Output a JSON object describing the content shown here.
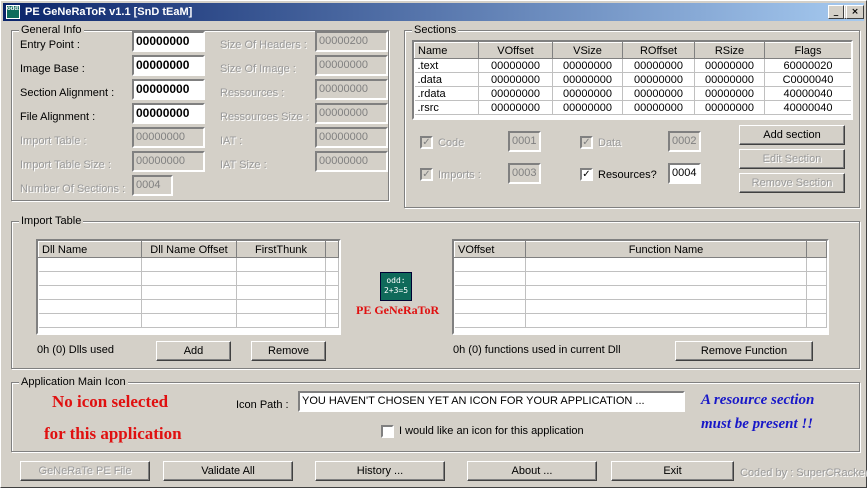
{
  "window": {
    "title": "PE GeNeRaToR v1.1 [SnD tEaM]",
    "app_icon": "pe-generator-icon",
    "minimize": "_",
    "maximize": "□",
    "close": "×"
  },
  "general_info": {
    "label": "General Info",
    "entry_point": {
      "label": "Entry Point :",
      "value": "00000000"
    },
    "image_base": {
      "label": "Image Base :",
      "value": "00000000"
    },
    "section_alignment": {
      "label": "Section Alignment :",
      "value": "00000000"
    },
    "file_alignment": {
      "label": "File Alignment :",
      "value": "00000000"
    },
    "import_table": {
      "label": "Import Table :",
      "value": "00000000"
    },
    "import_table_size": {
      "label": "Import Table Size :",
      "value": "00000000"
    },
    "number_of_sections": {
      "label": "Number Of Sections :",
      "value": "0004"
    },
    "size_of_headers": {
      "label": "Size Of Headers :",
      "value": "00000200"
    },
    "size_of_image": {
      "label": "Size Of Image :",
      "value": "00000000"
    },
    "ressources": {
      "label": "Ressources :",
      "value": "00000000"
    },
    "ressources_size": {
      "label": "Ressources Size :",
      "value": "00000000"
    },
    "iat": {
      "label": "IAT :",
      "value": "00000000"
    },
    "iat_size": {
      "label": "IAT Size :",
      "value": "00000000"
    }
  },
  "sections": {
    "label": "Sections",
    "columns": [
      "Name",
      "VOffset",
      "VSize",
      "ROffset",
      "RSize",
      "Flags"
    ],
    "rows": [
      [
        ".text",
        "00000000",
        "00000000",
        "00000000",
        "00000000",
        "60000020"
      ],
      [
        ".data",
        "00000000",
        "00000000",
        "00000000",
        "00000000",
        "C0000040"
      ],
      [
        ".rdata",
        "00000000",
        "00000000",
        "00000000",
        "00000000",
        "40000040"
      ],
      [
        ".rsrc",
        "00000000",
        "00000000",
        "00000000",
        "00000000",
        "40000040"
      ]
    ],
    "code": {
      "label": "Code",
      "value": "0001",
      "checked": "✓"
    },
    "data": {
      "label": "Data",
      "value": "0002",
      "checked": "✓"
    },
    "imports": {
      "label": "Imports :",
      "value": "0003",
      "checked": "✓"
    },
    "resources": {
      "label": "Resources?",
      "value": "0004",
      "checked": "✓"
    },
    "add_section": "Add section",
    "edit_section": "Edit Section",
    "remove_section": "Remove Section"
  },
  "import_table": {
    "label": "Import Table",
    "dll_columns": [
      "Dll Name",
      "Dll Name Offset",
      "FirstThunk"
    ],
    "dll_count": "0h (0) Dlls used",
    "add": "Add",
    "remove": "Remove",
    "func_columns": [
      "VOffset",
      "Function Name"
    ],
    "func_count": "0h (0) functions used in current Dll",
    "remove_function": "Remove Function",
    "logo_text": "PE GeNeRaToR",
    "logo_icon_line1": "odd:",
    "logo_icon_line2": "2+3=5"
  },
  "icon_group": {
    "label": "Application Main Icon",
    "no_icon_line1": "No icon selected",
    "no_icon_line2": "for this application",
    "icon_path_label": "Icon Path :",
    "icon_path_value": "YOU HAVEN'T CHOSEN YET AN ICON FOR YOUR APPLICATION ...",
    "checkbox_label": "I would like an icon for this application",
    "warning_line1": "A resource section",
    "warning_line2": "must be present !!"
  },
  "bottom": {
    "generate": "GeNeRaTe PE File",
    "validate": "Validate All",
    "history": "History ...",
    "about": "About ...",
    "exit": "Exit",
    "credit": "Coded by : SuperCRacker"
  }
}
